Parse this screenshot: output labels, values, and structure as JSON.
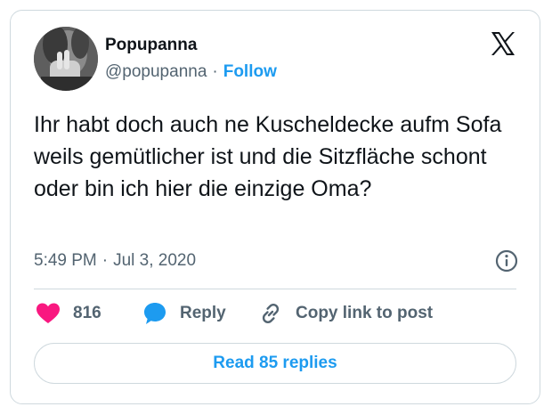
{
  "author": {
    "name": "Popupanna",
    "handle": "@popupanna",
    "separator": "·",
    "follow_label": "Follow"
  },
  "tweet": {
    "text": "Ihr habt doch auch ne Kuscheldecke aufm Sofa weils gemütlicher ist und die Sitzfläche schont oder bin ich hier die einzige Oma?",
    "time": "5:49 PM",
    "separator": "·",
    "date": "Jul 3, 2020"
  },
  "actions": {
    "likes_count": "816",
    "reply_label": "Reply",
    "copy_link_label": "Copy link to post"
  },
  "read_replies_label": "Read 85 replies",
  "colors": {
    "accent": "#1d9bf0",
    "like": "#f91880",
    "text": "#0f1419",
    "secondary": "#536471",
    "border": "#cfd9de"
  },
  "icons": {
    "logo": "x-logo-icon",
    "info": "info-icon",
    "like": "heart-icon",
    "reply": "speech-bubble-icon",
    "copy_link": "link-icon"
  }
}
